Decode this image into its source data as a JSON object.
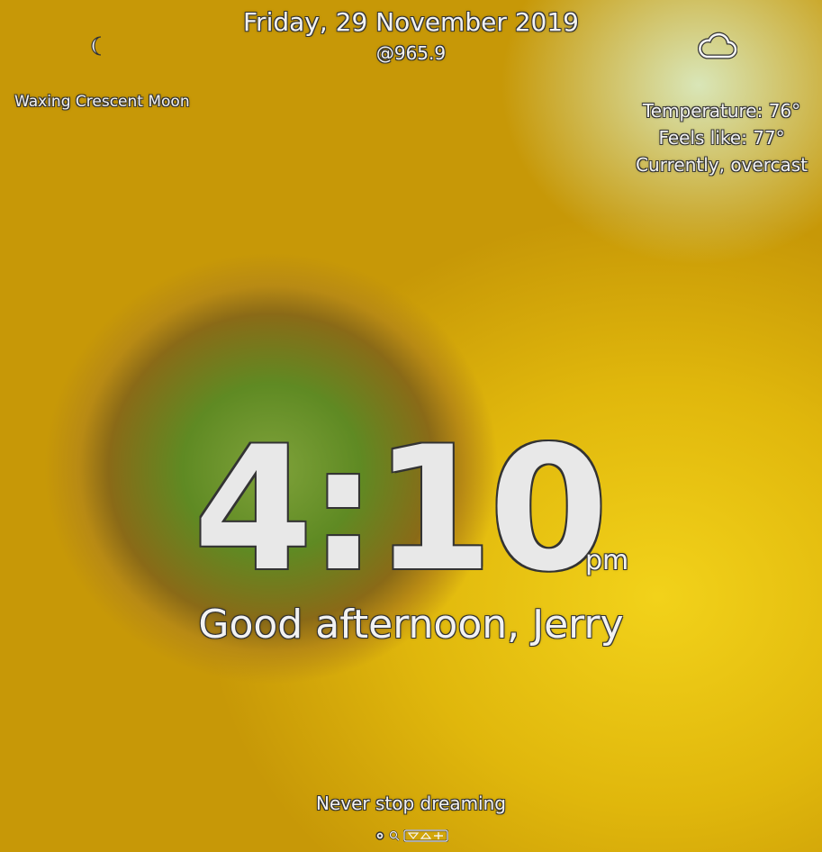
{
  "header": {
    "date": "Friday, 29 November 2019",
    "subtitle": "@965.9"
  },
  "moon": {
    "icon": "crescent-moon-icon",
    "label": "Waxing Crescent Moon"
  },
  "weather": {
    "icon": "cloud-icon",
    "temperature": "Temperature: 76°",
    "feels_like": "Feels like: 77°",
    "condition": "Currently, overcast"
  },
  "clock": {
    "time": "4:10",
    "ampm": "pm"
  },
  "greeting": "Good afternoon, Jerry",
  "quote": "Never stop dreaming",
  "bottom_icons": [
    "dot-icon",
    "search-icon",
    "toolbar-icon"
  ]
}
